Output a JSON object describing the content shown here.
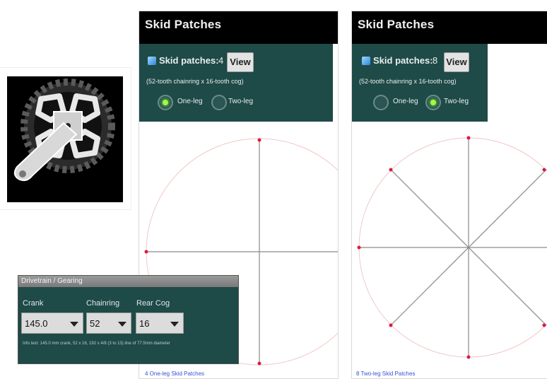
{
  "app_icon": {
    "name": "crankset-icon"
  },
  "screens": [
    {
      "title": "Skid Patches",
      "patches_label": "Skid patches:",
      "patches_count": "4",
      "view_label": "View",
      "subtitle": "(52-tooth chainring x 16-tooth cog)",
      "radio_one": "One-leg",
      "radio_two": "Two-leg",
      "selected": "One-leg",
      "footer": "4 One-leg Skid Patches"
    },
    {
      "title": "Skid Patches",
      "patches_label": "Skid patches:",
      "patches_count": "8",
      "view_label": "View",
      "subtitle": "(52-tooth chainring x 16-tooth cog)",
      "radio_one": "One-leg",
      "radio_two": "Two-leg",
      "selected": "Two-leg",
      "footer": "8 Two-leg Skid Patches"
    }
  ],
  "dialog": {
    "title": "Drivetrain / Gearing",
    "crank_label": "Crank",
    "crank_value": "145.0",
    "chainring_label": "Chainring",
    "chainring_value": "52",
    "cog_label": "Rear Cog",
    "cog_value": "16",
    "info": "Info text: 145.0 mm crank, 52 x 16, 192 x 4/8 (3 to 13) line of 77.5mm diameter"
  },
  "colors": {
    "panel": "#1e4a47",
    "titlebar": "#000000",
    "patch_marker": "#e01840",
    "radio_on": "#9aff3c",
    "link": "#3a50d8"
  }
}
